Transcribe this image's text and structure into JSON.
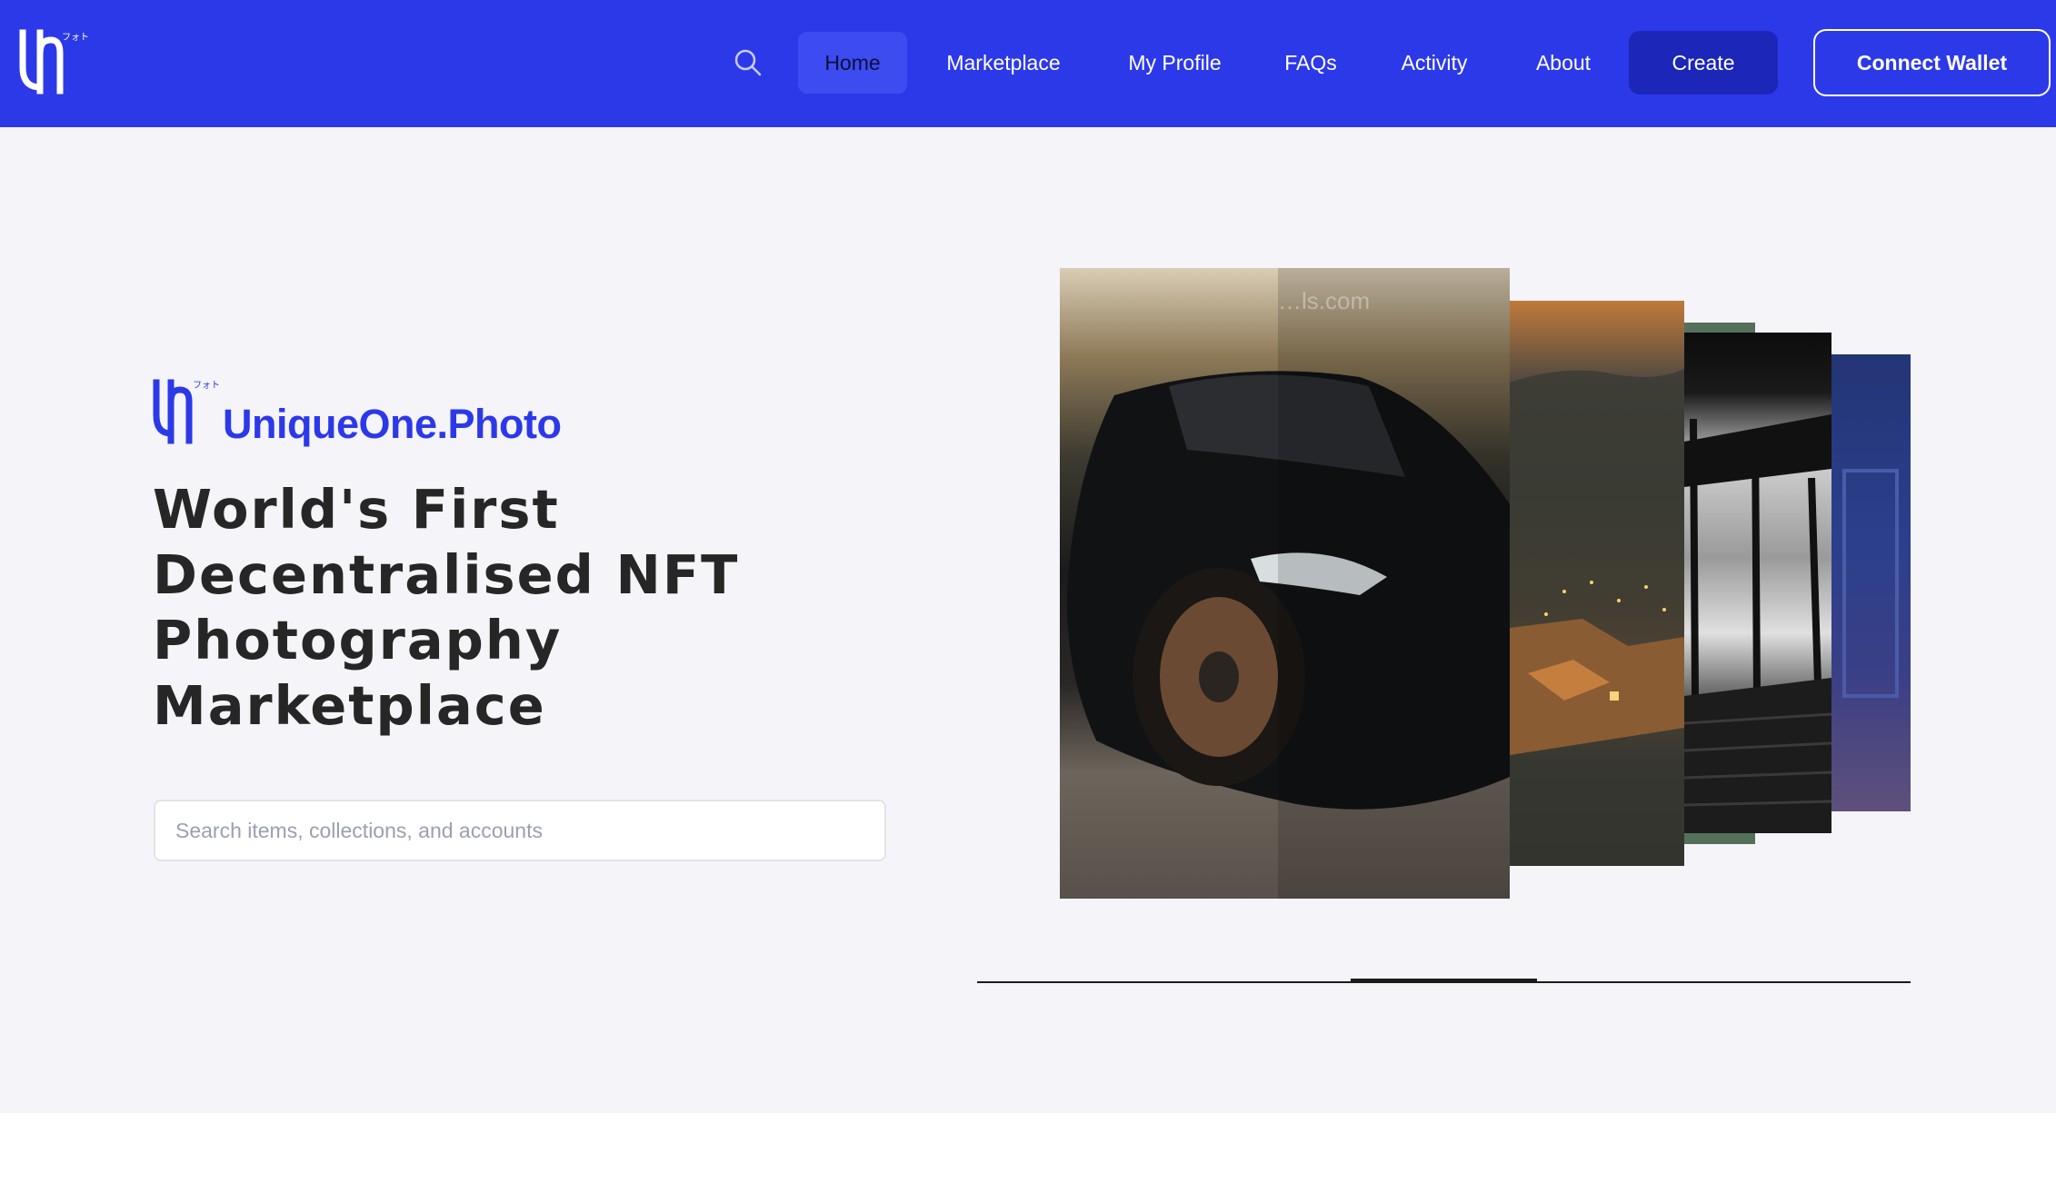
{
  "navbar": {
    "logo_icon": "uniqueone-logo-icon",
    "logo_kana": "フォト",
    "search_icon": "search-icon",
    "items": [
      {
        "label": "Home",
        "active": true
      },
      {
        "label": "Marketplace",
        "active": false
      },
      {
        "label": "My Profile",
        "active": false
      },
      {
        "label": "FAQs",
        "active": false
      },
      {
        "label": "Activity",
        "active": false
      },
      {
        "label": "About",
        "active": false
      }
    ],
    "create_label": "Create",
    "connect_wallet_label": "Connect Wallet"
  },
  "hero": {
    "brand_name": "UniqueOne.Photo",
    "brand_kana": "フォト",
    "title_lines": [
      "World's First",
      "Decentralised NFT",
      "Photography",
      "Marketplace"
    ],
    "search": {
      "placeholder": "Search items, collections, and accounts",
      "value": ""
    }
  },
  "carousel": {
    "slides": [
      {
        "name": "car-photo",
        "watermark": "…ls.com"
      },
      {
        "name": "hill-town-photo"
      },
      {
        "name": "green-photo"
      },
      {
        "name": "staircase-photo"
      },
      {
        "name": "blue-photo"
      }
    ],
    "progress": 0.2,
    "active_slide": 3
  },
  "colors": {
    "brand_blue": "#2c39e8",
    "create_button": "#1c26b8",
    "hero_background": "#f4f4f9",
    "title_text": "#262626"
  }
}
